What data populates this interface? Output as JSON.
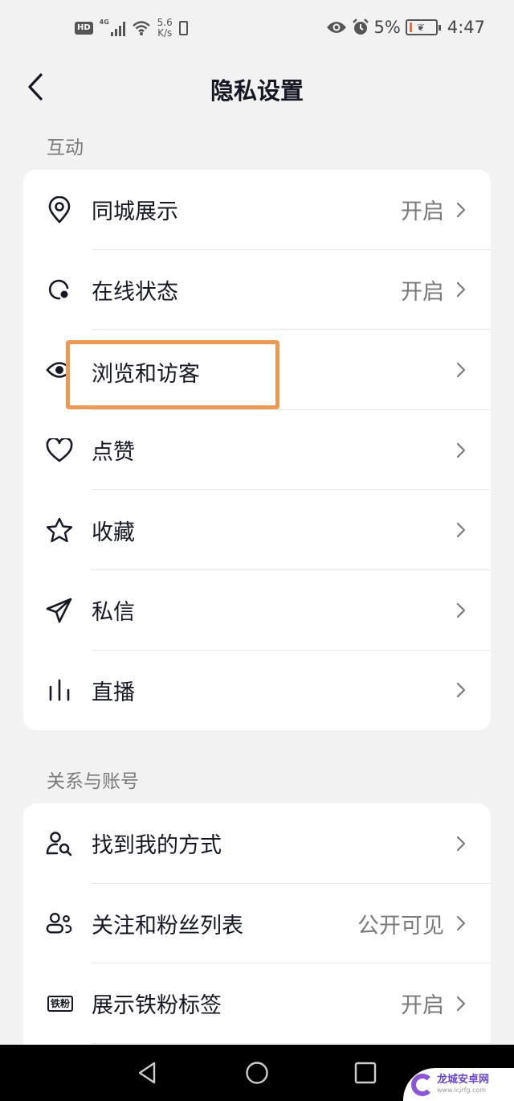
{
  "status_bar": {
    "hd": "HD",
    "network": "4G",
    "speed_value": "5.6",
    "speed_unit": "K/s",
    "battery_percent": "5%",
    "time": "4:47"
  },
  "header": {
    "title": "隐私设置"
  },
  "sections": [
    {
      "label": "互动",
      "items": [
        {
          "icon": "location-pin-icon",
          "label": "同城展示",
          "value": "开启"
        },
        {
          "icon": "online-status-icon",
          "label": "在线状态",
          "value": "开启"
        },
        {
          "icon": "eye-icon",
          "label": "浏览和访客",
          "value": ""
        },
        {
          "icon": "heart-icon",
          "label": "点赞",
          "value": ""
        },
        {
          "icon": "star-icon",
          "label": "收藏",
          "value": ""
        },
        {
          "icon": "send-icon",
          "label": "私信",
          "value": ""
        },
        {
          "icon": "live-bars-icon",
          "label": "直播",
          "value": ""
        }
      ]
    },
    {
      "label": "关系与账号",
      "items": [
        {
          "icon": "user-search-icon",
          "label": "找到我的方式",
          "value": ""
        },
        {
          "icon": "users-icon",
          "label": "关注和粉丝列表",
          "value": "公开可见"
        },
        {
          "icon": "iron-fan-badge-icon",
          "icon_text": "铁粉",
          "label": "展示铁粉标签",
          "value": "开启"
        }
      ]
    }
  ],
  "highlight": {
    "label": "浏览和访客",
    "color": "#ec9a53"
  },
  "watermark": {
    "title": "龙城安卓网",
    "url": "www.lcjrfg.com"
  }
}
